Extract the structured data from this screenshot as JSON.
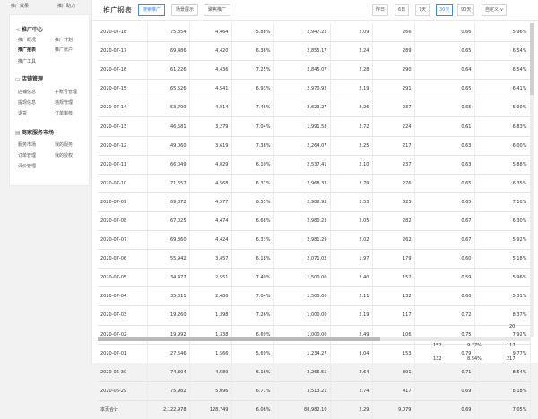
{
  "topbar": {
    "left": "推广效果",
    "right": "推广助力"
  },
  "sidebar": {
    "sections": [
      {
        "title": "推广中心",
        "icon": "share-icon",
        "items": [
          [
            "推广概况",
            "推广计划"
          ],
          [
            "推广报表",
            "推广账户"
          ],
          [
            "推广工具",
            ""
          ]
        ]
      },
      {
        "title": "店铺管理",
        "icon": "shop-icon",
        "items": [
          [
            "店铺信息",
            "子账号管理"
          ],
          [
            "提现信息",
            "违规管理"
          ],
          [
            "退货",
            "订单审核"
          ]
        ]
      },
      {
        "title": "商家服务市场",
        "icon": "market-icon",
        "items": [
          [
            "服务市场",
            "我的服务"
          ],
          [
            "订单管理",
            "我的授权"
          ],
          [
            "评价管理",
            ""
          ]
        ]
      }
    ]
  },
  "header": {
    "title": "推广报表"
  },
  "tabs": [
    "搜索推广",
    "场景展示",
    "聚焦推广"
  ],
  "date_buttons": [
    "昨日",
    "6日",
    "7天",
    "30天",
    "90天",
    "自定义 ∨"
  ],
  "table": {
    "rows": [
      [
        "2020-07-18",
        "75,854",
        "4,464",
        "5.88%",
        "2,947.22",
        "2.09",
        "266",
        "0.66",
        "5.96%"
      ],
      [
        "2020-07-17",
        "69,486",
        "4,420",
        "6.36%",
        "2,855.17",
        "2.24",
        "289",
        "0.65",
        "6.54%"
      ],
      [
        "2020-07-16",
        "61,226",
        "4,436",
        "7.25%",
        "2,845.07",
        "2.28",
        "290",
        "0.64",
        "6.54%"
      ],
      [
        "2020-07-15",
        "65,526",
        "4,541",
        "6.93%",
        "2,970.92",
        "2.19",
        "291",
        "0.65",
        "6.41%"
      ],
      [
        "2020-07-14",
        "53,799",
        "4,014",
        "7.46%",
        "2,623.27",
        "2.26",
        "237",
        "0.65",
        "5.90%"
      ],
      [
        "2020-07-13",
        "46,581",
        "3,279",
        "7.04%",
        "1,991.58",
        "2.72",
        "224",
        "0.61",
        "6.83%"
      ],
      [
        "2020-07-12",
        "49,060",
        "3,619",
        "7.38%",
        "2,264.07",
        "2.25",
        "217",
        "0.63",
        "6.00%"
      ],
      [
        "2020-07-11",
        "66,049",
        "4,029",
        "6.10%",
        "2,537.41",
        "2.10",
        "237",
        "0.63",
        "5.88%"
      ],
      [
        "2020-07-10",
        "71,657",
        "4,568",
        "6.37%",
        "2,968.33",
        "2.79",
        "276",
        "0.65",
        "6.35%"
      ],
      [
        "2020-07-09",
        "69,872",
        "4,577",
        "6.55%",
        "2,982.93",
        "2.53",
        "325",
        "0.65",
        "7.10%"
      ],
      [
        "2020-07-08",
        "67,025",
        "4,474",
        "6.68%",
        "2,980.23",
        "2.05",
        "282",
        "0.67",
        "6.30%"
      ],
      [
        "2020-07-07",
        "69,860",
        "4,424",
        "6.33%",
        "2,981.29",
        "2.02",
        "262",
        "0.67",
        "5.92%"
      ],
      [
        "2020-07-06",
        "55,942",
        "3,457",
        "6.18%",
        "2,071.02",
        "1.97",
        "179",
        "0.60",
        "5.18%"
      ],
      [
        "2020-07-05",
        "34,477",
        "2,551",
        "7.40%",
        "1,500.00",
        "2.40",
        "152",
        "0.59",
        "5.96%"
      ],
      [
        "2020-07-04",
        "35,311",
        "2,486",
        "7.04%",
        "1,500.00",
        "2.11",
        "132",
        "0.60",
        "5.31%"
      ],
      [
        "2020-07-03",
        "19,260",
        "1,398",
        "7.26%",
        "1,000.00",
        "2.19",
        "117",
        "0.72",
        "8.37%"
      ],
      [
        "2020-07-02",
        "19,992",
        "1,338",
        "6.69%",
        "1,000.00",
        "2.49",
        "106",
        "0.75",
        "7.92%"
      ],
      [
        "2020-07-01",
        "27,546",
        "1,566",
        "5.69%",
        "1,234.27",
        "3.04",
        "153",
        "0.79",
        "9.77%"
      ],
      [
        "2020-06-30",
        "74,304",
        "4,580",
        "6.16%",
        "2,266.55",
        "2.64",
        "391",
        "0.71",
        "8.54%"
      ],
      [
        "2020-06-29",
        "75,982",
        "5,096",
        "6.71%",
        "3,513.21",
        "2.74",
        "417",
        "0.69",
        "8.18%"
      ]
    ],
    "total": [
      "本页合计",
      "2,122,978",
      "128,749",
      "6.06%",
      "88,982.10",
      "2.29",
      "9,079",
      "0.69",
      "7.05%"
    ]
  },
  "overflow": [
    [
      "20"
    ],
    [
      "152",
      "9.77%",
      "117"
    ],
    [
      "132",
      "8.54%",
      "217"
    ]
  ]
}
